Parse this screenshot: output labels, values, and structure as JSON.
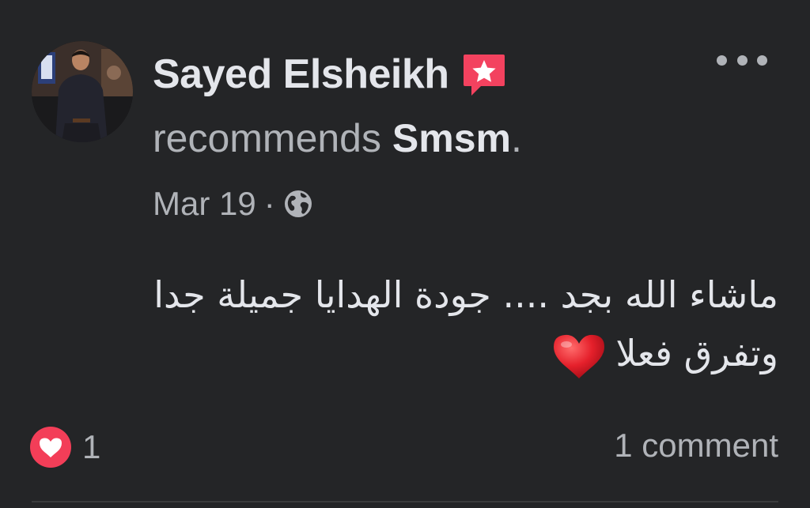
{
  "post": {
    "author": {
      "name": "Sayed Elsheikh",
      "avatar_alt": "Sayed Elsheikh profile photo"
    },
    "recommendation": {
      "verb": "recommends ",
      "page_name": "Smsm",
      "suffix": "."
    },
    "meta": {
      "date": "Mar 19",
      "separator": "·",
      "audience_icon": "globe-icon"
    },
    "more_icon": "more-horizontal-icon",
    "badge_icon": "recommendation-star-badge-icon",
    "text": {
      "line1": "ماشاء الله بجد .... جودة الهدايا جميلة جدا",
      "line2": "وتفرق فعلا",
      "emoji": "heart-emoji"
    },
    "reactions": {
      "icon": "love-reaction-icon",
      "count": "1"
    },
    "comments": {
      "label": "1 comment"
    }
  },
  "colors": {
    "background": "#242527",
    "primary_text": "#e4e6eb",
    "secondary_text": "#b0b3b8",
    "badge": "#f3425f",
    "love_reaction": "#f33e58",
    "divider": "#3a3b3c"
  }
}
